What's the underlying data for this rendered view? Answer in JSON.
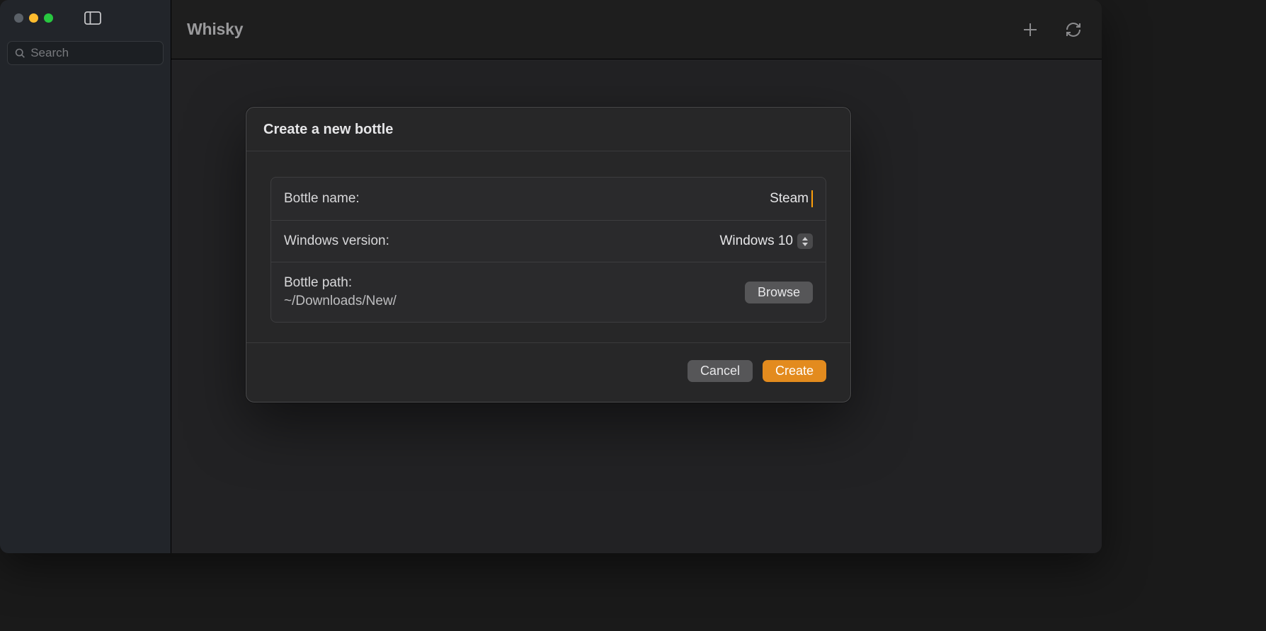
{
  "app": {
    "title": "Whisky"
  },
  "sidebar": {
    "search_placeholder": "Search"
  },
  "dialog": {
    "title": "Create a new bottle",
    "fields": {
      "bottle_name_label": "Bottle name:",
      "bottle_name_value": "Steam",
      "windows_version_label": "Windows version:",
      "windows_version_value": "Windows 10",
      "bottle_path_label": "Bottle path:",
      "bottle_path_value": "~/Downloads/New/",
      "browse_label": "Browse"
    },
    "buttons": {
      "cancel": "Cancel",
      "create": "Create"
    }
  }
}
